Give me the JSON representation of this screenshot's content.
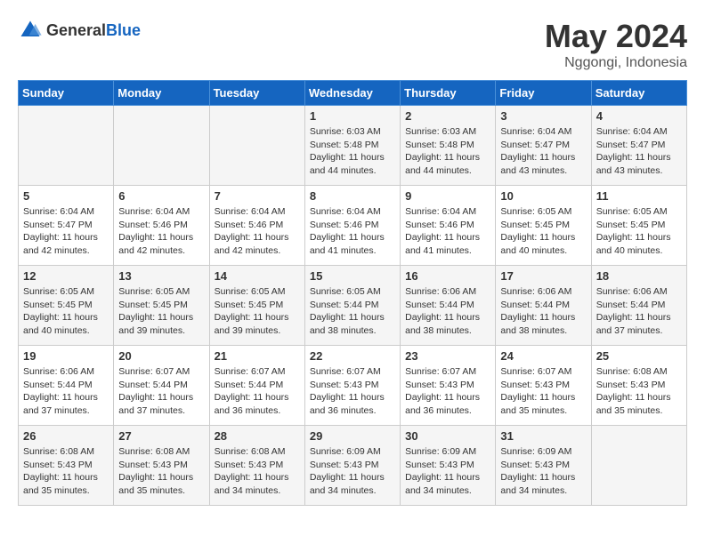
{
  "header": {
    "logo_general": "General",
    "logo_blue": "Blue",
    "title": "May 2024",
    "subtitle": "Nggongi, Indonesia"
  },
  "days_of_week": [
    "Sunday",
    "Monday",
    "Tuesday",
    "Wednesday",
    "Thursday",
    "Friday",
    "Saturday"
  ],
  "weeks": [
    [
      {
        "day": "",
        "content": ""
      },
      {
        "day": "",
        "content": ""
      },
      {
        "day": "",
        "content": ""
      },
      {
        "day": "1",
        "content": "Sunrise: 6:03 AM\nSunset: 5:48 PM\nDaylight: 11 hours and 44 minutes."
      },
      {
        "day": "2",
        "content": "Sunrise: 6:03 AM\nSunset: 5:48 PM\nDaylight: 11 hours and 44 minutes."
      },
      {
        "day": "3",
        "content": "Sunrise: 6:04 AM\nSunset: 5:47 PM\nDaylight: 11 hours and 43 minutes."
      },
      {
        "day": "4",
        "content": "Sunrise: 6:04 AM\nSunset: 5:47 PM\nDaylight: 11 hours and 43 minutes."
      }
    ],
    [
      {
        "day": "5",
        "content": "Sunrise: 6:04 AM\nSunset: 5:47 PM\nDaylight: 11 hours and 42 minutes."
      },
      {
        "day": "6",
        "content": "Sunrise: 6:04 AM\nSunset: 5:46 PM\nDaylight: 11 hours and 42 minutes."
      },
      {
        "day": "7",
        "content": "Sunrise: 6:04 AM\nSunset: 5:46 PM\nDaylight: 11 hours and 42 minutes."
      },
      {
        "day": "8",
        "content": "Sunrise: 6:04 AM\nSunset: 5:46 PM\nDaylight: 11 hours and 41 minutes."
      },
      {
        "day": "9",
        "content": "Sunrise: 6:04 AM\nSunset: 5:46 PM\nDaylight: 11 hours and 41 minutes."
      },
      {
        "day": "10",
        "content": "Sunrise: 6:05 AM\nSunset: 5:45 PM\nDaylight: 11 hours and 40 minutes."
      },
      {
        "day": "11",
        "content": "Sunrise: 6:05 AM\nSunset: 5:45 PM\nDaylight: 11 hours and 40 minutes."
      }
    ],
    [
      {
        "day": "12",
        "content": "Sunrise: 6:05 AM\nSunset: 5:45 PM\nDaylight: 11 hours and 40 minutes."
      },
      {
        "day": "13",
        "content": "Sunrise: 6:05 AM\nSunset: 5:45 PM\nDaylight: 11 hours and 39 minutes."
      },
      {
        "day": "14",
        "content": "Sunrise: 6:05 AM\nSunset: 5:45 PM\nDaylight: 11 hours and 39 minutes."
      },
      {
        "day": "15",
        "content": "Sunrise: 6:05 AM\nSunset: 5:44 PM\nDaylight: 11 hours and 38 minutes."
      },
      {
        "day": "16",
        "content": "Sunrise: 6:06 AM\nSunset: 5:44 PM\nDaylight: 11 hours and 38 minutes."
      },
      {
        "day": "17",
        "content": "Sunrise: 6:06 AM\nSunset: 5:44 PM\nDaylight: 11 hours and 38 minutes."
      },
      {
        "day": "18",
        "content": "Sunrise: 6:06 AM\nSunset: 5:44 PM\nDaylight: 11 hours and 37 minutes."
      }
    ],
    [
      {
        "day": "19",
        "content": "Sunrise: 6:06 AM\nSunset: 5:44 PM\nDaylight: 11 hours and 37 minutes."
      },
      {
        "day": "20",
        "content": "Sunrise: 6:07 AM\nSunset: 5:44 PM\nDaylight: 11 hours and 37 minutes."
      },
      {
        "day": "21",
        "content": "Sunrise: 6:07 AM\nSunset: 5:44 PM\nDaylight: 11 hours and 36 minutes."
      },
      {
        "day": "22",
        "content": "Sunrise: 6:07 AM\nSunset: 5:43 PM\nDaylight: 11 hours and 36 minutes."
      },
      {
        "day": "23",
        "content": "Sunrise: 6:07 AM\nSunset: 5:43 PM\nDaylight: 11 hours and 36 minutes."
      },
      {
        "day": "24",
        "content": "Sunrise: 6:07 AM\nSunset: 5:43 PM\nDaylight: 11 hours and 35 minutes."
      },
      {
        "day": "25",
        "content": "Sunrise: 6:08 AM\nSunset: 5:43 PM\nDaylight: 11 hours and 35 minutes."
      }
    ],
    [
      {
        "day": "26",
        "content": "Sunrise: 6:08 AM\nSunset: 5:43 PM\nDaylight: 11 hours and 35 minutes."
      },
      {
        "day": "27",
        "content": "Sunrise: 6:08 AM\nSunset: 5:43 PM\nDaylight: 11 hours and 35 minutes."
      },
      {
        "day": "28",
        "content": "Sunrise: 6:08 AM\nSunset: 5:43 PM\nDaylight: 11 hours and 34 minutes."
      },
      {
        "day": "29",
        "content": "Sunrise: 6:09 AM\nSunset: 5:43 PM\nDaylight: 11 hours and 34 minutes."
      },
      {
        "day": "30",
        "content": "Sunrise: 6:09 AM\nSunset: 5:43 PM\nDaylight: 11 hours and 34 minutes."
      },
      {
        "day": "31",
        "content": "Sunrise: 6:09 AM\nSunset: 5:43 PM\nDaylight: 11 hours and 34 minutes."
      },
      {
        "day": "",
        "content": ""
      }
    ]
  ]
}
